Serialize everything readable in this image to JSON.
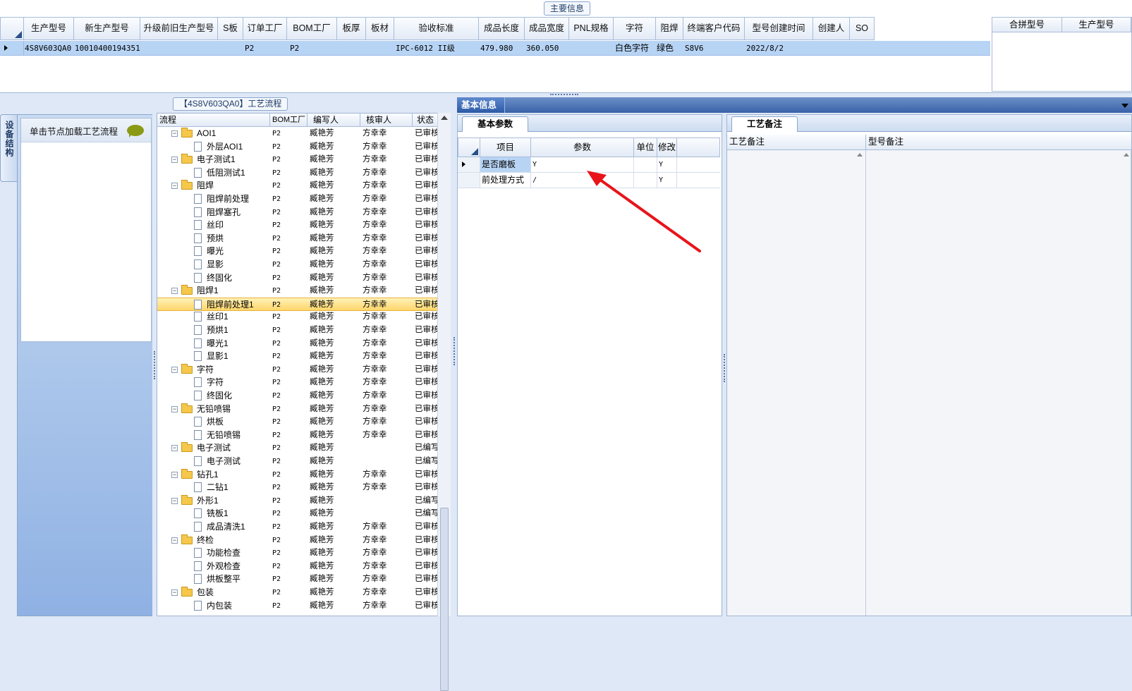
{
  "top": {
    "caption": "主要信息",
    "columns": [
      "生产型号",
      "新生产型号",
      "升级前旧生产型号",
      "S板",
      "订单工厂",
      "BOM工厂",
      "板厚",
      "板材",
      "验收标准",
      "成品长度",
      "成品宽度",
      "PNL规格",
      "字符",
      "阻焊",
      "终端客户代码",
      "型号创建时间",
      "创建人",
      "SO"
    ],
    "row": {
      "prod_model": "4S8V603QA0",
      "new_model": "10010400194351",
      "order_factory": "P2",
      "bom_factory": "P2",
      "standard": "IPC-6012 II级",
      "length": "479.980",
      "width": "360.050",
      "char": "白色字符",
      "solder": "绿色",
      "customer_code": "S8V6",
      "created": "2022/8/2"
    },
    "merge_columns": [
      "合拼型号",
      "生产型号"
    ]
  },
  "left": {
    "vtab": "设备结构",
    "load_label": "单击节点加载工艺流程"
  },
  "tree": {
    "caption": "【4S8V603QA0】工艺流程",
    "columns": [
      "流程",
      "BOM工厂",
      "编写人",
      "核审人",
      "状态"
    ],
    "rows": [
      {
        "name": "AOI1",
        "level": 0,
        "bom": "P2",
        "writer": "臧艳芳",
        "reviewer": "方幸幸",
        "status": "已审核"
      },
      {
        "name": "外层AOI1",
        "level": 1,
        "bom": "P2",
        "writer": "臧艳芳",
        "reviewer": "方幸幸",
        "status": "已审核"
      },
      {
        "name": "电子测试1",
        "level": 0,
        "bom": "P2",
        "writer": "臧艳芳",
        "reviewer": "方幸幸",
        "status": "已审核"
      },
      {
        "name": "低阻测试1",
        "level": 1,
        "bom": "P2",
        "writer": "臧艳芳",
        "reviewer": "方幸幸",
        "status": "已审核"
      },
      {
        "name": "阻焊",
        "level": 0,
        "bom": "P2",
        "writer": "臧艳芳",
        "reviewer": "方幸幸",
        "status": "已审核"
      },
      {
        "name": "阻焊前处理",
        "level": 1,
        "bom": "P2",
        "writer": "臧艳芳",
        "reviewer": "方幸幸",
        "status": "已审核"
      },
      {
        "name": "阻焊塞孔",
        "level": 1,
        "bom": "P2",
        "writer": "臧艳芳",
        "reviewer": "方幸幸",
        "status": "已审核"
      },
      {
        "name": "丝印",
        "level": 1,
        "bom": "P2",
        "writer": "臧艳芳",
        "reviewer": "方幸幸",
        "status": "已审核"
      },
      {
        "name": "预烘",
        "level": 1,
        "bom": "P2",
        "writer": "臧艳芳",
        "reviewer": "方幸幸",
        "status": "已审核"
      },
      {
        "name": "曝光",
        "level": 1,
        "bom": "P2",
        "writer": "臧艳芳",
        "reviewer": "方幸幸",
        "status": "已审核"
      },
      {
        "name": "显影",
        "level": 1,
        "bom": "P2",
        "writer": "臧艳芳",
        "reviewer": "方幸幸",
        "status": "已审核"
      },
      {
        "name": "终固化",
        "level": 1,
        "bom": "P2",
        "writer": "臧艳芳",
        "reviewer": "方幸幸",
        "status": "已审核"
      },
      {
        "name": "阻焊1",
        "level": 0,
        "bom": "P2",
        "writer": "臧艳芳",
        "reviewer": "方幸幸",
        "status": "已审核"
      },
      {
        "name": "阻焊前处理1",
        "level": 1,
        "bom": "P2",
        "writer": "臧艳芳",
        "reviewer": "方幸幸",
        "status": "已审核",
        "selected": true
      },
      {
        "name": "丝印1",
        "level": 1,
        "bom": "P2",
        "writer": "臧艳芳",
        "reviewer": "方幸幸",
        "status": "已审核"
      },
      {
        "name": "预烘1",
        "level": 1,
        "bom": "P2",
        "writer": "臧艳芳",
        "reviewer": "方幸幸",
        "status": "已审核"
      },
      {
        "name": "曝光1",
        "level": 1,
        "bom": "P2",
        "writer": "臧艳芳",
        "reviewer": "方幸幸",
        "status": "已审核"
      },
      {
        "name": "显影1",
        "level": 1,
        "bom": "P2",
        "writer": "臧艳芳",
        "reviewer": "方幸幸",
        "status": "已审核"
      },
      {
        "name": "字符",
        "level": 0,
        "bom": "P2",
        "writer": "臧艳芳",
        "reviewer": "方幸幸",
        "status": "已审核"
      },
      {
        "name": "字符",
        "level": 1,
        "bom": "P2",
        "writer": "臧艳芳",
        "reviewer": "方幸幸",
        "status": "已审核"
      },
      {
        "name": "终固化",
        "level": 1,
        "bom": "P2",
        "writer": "臧艳芳",
        "reviewer": "方幸幸",
        "status": "已审核"
      },
      {
        "name": "无铅喷锡",
        "level": 0,
        "bom": "P2",
        "writer": "臧艳芳",
        "reviewer": "方幸幸",
        "status": "已审核"
      },
      {
        "name": "烘板",
        "level": 1,
        "bom": "P2",
        "writer": "臧艳芳",
        "reviewer": "方幸幸",
        "status": "已审核"
      },
      {
        "name": "无铅喷锡",
        "level": 1,
        "bom": "P2",
        "writer": "臧艳芳",
        "reviewer": "方幸幸",
        "status": "已审核"
      },
      {
        "name": "电子测试",
        "level": 0,
        "bom": "P2",
        "writer": "臧艳芳",
        "reviewer": "",
        "status": "已编写"
      },
      {
        "name": "电子测试",
        "level": 1,
        "bom": "P2",
        "writer": "臧艳芳",
        "reviewer": "",
        "status": "已编写"
      },
      {
        "name": "钻孔1",
        "level": 0,
        "bom": "P2",
        "writer": "臧艳芳",
        "reviewer": "方幸幸",
        "status": "已审核"
      },
      {
        "name": "二钻1",
        "level": 1,
        "bom": "P2",
        "writer": "臧艳芳",
        "reviewer": "方幸幸",
        "status": "已审核"
      },
      {
        "name": "外形1",
        "level": 0,
        "bom": "P2",
        "writer": "臧艳芳",
        "reviewer": "",
        "status": "已编写"
      },
      {
        "name": "铣板1",
        "level": 1,
        "bom": "P2",
        "writer": "臧艳芳",
        "reviewer": "",
        "status": "已编写"
      },
      {
        "name": "成品清洗1",
        "level": 1,
        "bom": "P2",
        "writer": "臧艳芳",
        "reviewer": "方幸幸",
        "status": "已审核"
      },
      {
        "name": "终检",
        "level": 0,
        "bom": "P2",
        "writer": "臧艳芳",
        "reviewer": "方幸幸",
        "status": "已审核"
      },
      {
        "name": "功能检查",
        "level": 1,
        "bom": "P2",
        "writer": "臧艳芳",
        "reviewer": "方幸幸",
        "status": "已审核"
      },
      {
        "name": "外观检查",
        "level": 1,
        "bom": "P2",
        "writer": "臧艳芳",
        "reviewer": "方幸幸",
        "status": "已审核"
      },
      {
        "name": "烘板整平",
        "level": 1,
        "bom": "P2",
        "writer": "臧艳芳",
        "reviewer": "方幸幸",
        "status": "已审核"
      },
      {
        "name": "包装",
        "level": 0,
        "bom": "P2",
        "writer": "臧艳芳",
        "reviewer": "方幸幸",
        "status": "已审核"
      },
      {
        "name": "内包装",
        "level": 1,
        "bom": "P2",
        "writer": "臧艳芳",
        "reviewer": "方幸幸",
        "status": "已审核"
      }
    ]
  },
  "basic": {
    "header_tab": "基本信息",
    "params_tab": "基本参数",
    "columns": [
      "项目",
      "参数",
      "单位",
      "修改"
    ],
    "rows": [
      {
        "item": "是否磨板",
        "param": "Y",
        "unit": "",
        "modify": "Y"
      },
      {
        "item": "前处理方式",
        "param": "/",
        "unit": "",
        "modify": "Y"
      }
    ]
  },
  "remarks": {
    "tab": "工艺备注",
    "process_note": "工艺备注",
    "model_note": "型号备注"
  },
  "colors": {
    "accent": "#3a62a8",
    "selection": "#ffd66b",
    "row_highlight": "#b7d4f5",
    "arrow": "#e8141a"
  }
}
